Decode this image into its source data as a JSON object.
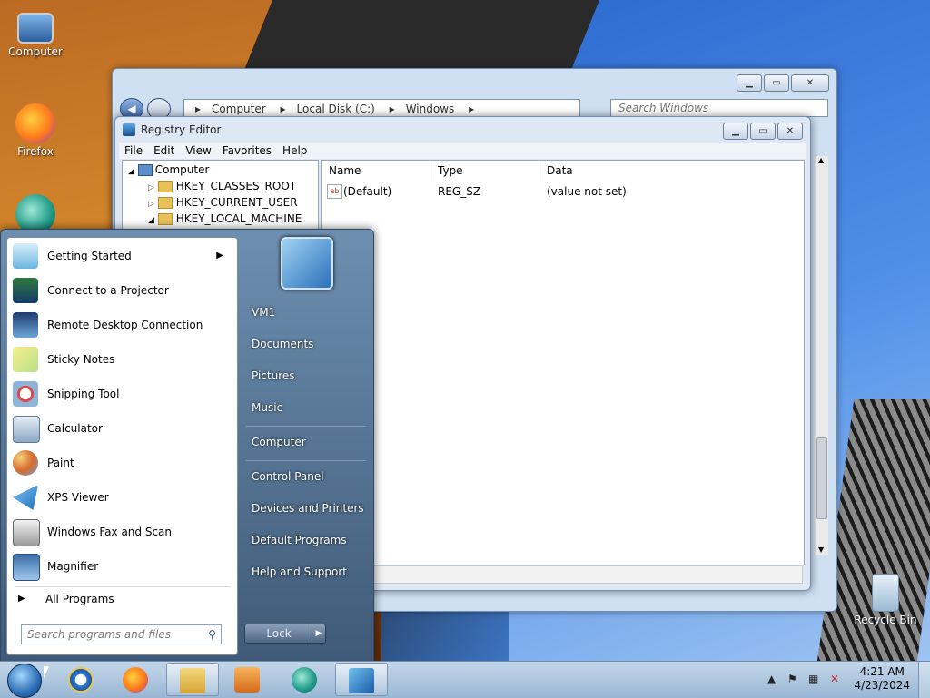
{
  "desktop": {
    "icons": [
      {
        "label": "Computer",
        "icon": "computer-icon"
      },
      {
        "label": "Firefox",
        "icon": "firefox-icon"
      },
      {
        "label": "",
        "icon": "app-icon"
      },
      {
        "label": "Recycle Bin",
        "icon": "recycle-bin-icon"
      }
    ]
  },
  "explorer": {
    "breadcrumb": [
      "Computer",
      "Local Disk (C:)",
      "Windows"
    ],
    "search_placeholder": "Search Windows"
  },
  "regedit": {
    "title": "Registry Editor",
    "menu": [
      "File",
      "Edit",
      "View",
      "Favorites",
      "Help"
    ],
    "tree": {
      "root": "Computer",
      "keys": [
        "HKEY_CLASSES_ROOT",
        "HKEY_CURRENT_USER",
        "HKEY_LOCAL_MACHINE"
      ]
    },
    "columns": [
      "Name",
      "Type",
      "Data"
    ],
    "values": [
      {
        "icon": "ab",
        "name": "(Default)",
        "type": "REG_SZ",
        "data": "(value not set)"
      }
    ]
  },
  "startmenu": {
    "programs": [
      {
        "label": "Getting Started",
        "has_submenu": true,
        "icon": "getting-started-icon"
      },
      {
        "label": "Connect to a Projector",
        "icon": "projector-icon"
      },
      {
        "label": "Remote Desktop Connection",
        "icon": "remote-desktop-icon"
      },
      {
        "label": "Sticky Notes",
        "icon": "sticky-notes-icon"
      },
      {
        "label": "Snipping Tool",
        "icon": "snipping-tool-icon"
      },
      {
        "label": "Calculator",
        "icon": "calculator-icon"
      },
      {
        "label": "Paint",
        "icon": "paint-icon"
      },
      {
        "label": "XPS Viewer",
        "icon": "xps-viewer-icon"
      },
      {
        "label": "Windows Fax and Scan",
        "icon": "fax-scan-icon"
      },
      {
        "label": "Magnifier",
        "icon": "magnifier-icon"
      }
    ],
    "all_programs": "All Programs",
    "search_placeholder": "Search programs and files",
    "right_items": [
      "VM1",
      "Documents",
      "Pictures",
      "Music",
      "Computer",
      "Control Panel",
      "Devices and Printers",
      "Default Programs",
      "Help and Support"
    ],
    "lock_label": "Lock",
    "lock_arrow": "▶"
  },
  "taskbar": {
    "apps": [
      "internet-explorer-icon",
      "firefox-icon",
      "explorer-icon",
      "media-player-icon",
      "app-icon",
      "regedit-icon"
    ],
    "clock_time": "4:21 AM",
    "clock_date": "4/23/2024"
  },
  "colors": {
    "start_menu_right": "#4f6b8c",
    "taskbar": "#b5cbe1",
    "window_frame": "#cfe0f2"
  }
}
